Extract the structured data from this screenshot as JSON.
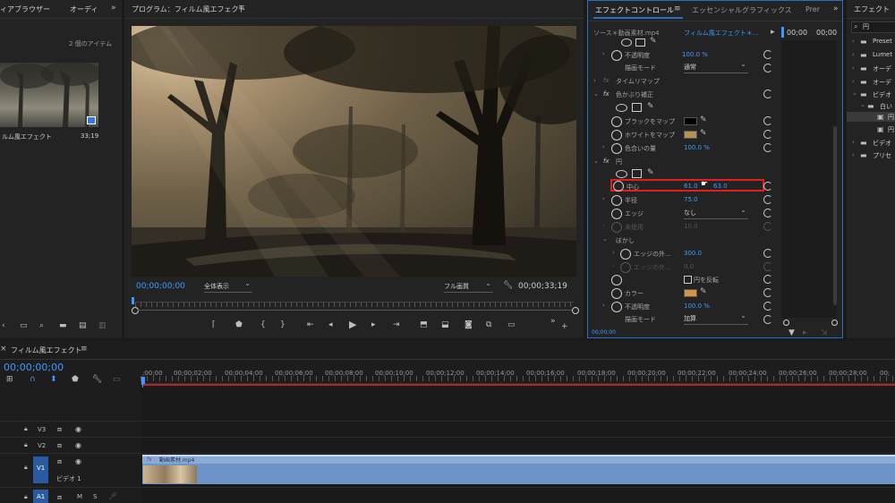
{
  "project_panel": {
    "tab_media_browser": "ィアブラウザー",
    "tab_audio": "オーディ",
    "item_count": "2 個のアイテム",
    "clip_name": "ルム風エフェクト",
    "clip_duration": "33;19"
  },
  "program_monitor": {
    "title": "プログラム：フィルム風エフェクト",
    "timecode_current": "00;00;00;00",
    "zoom_select": "全体表示",
    "quality_select": "フル画質",
    "timecode_duration": "00;00;33;19"
  },
  "effect_controls": {
    "tab_active": "エフェクトコントロール",
    "tab_essential": "エッセンシャルグラフィックス",
    "tab_more": "Prer",
    "source_label": "ソース＊動画素材.mp4",
    "sequence_label": "フィルム風エフェクト＊...",
    "mini_timecode": "00;00",
    "mini_timecode2": "00;00",
    "bottom_timecode": "00;00;00",
    "rows": [
      {
        "label": "不透明度",
        "value": "100.0 %"
      },
      {
        "label": "描画モード",
        "value": "通常"
      },
      {
        "label": "タイムリマップ",
        "value": ""
      },
      {
        "label": "色かぶり補正",
        "value": ""
      },
      {
        "label": "ブラックをマップ",
        "value": ""
      },
      {
        "label": "ホワイトをマップ",
        "value": ""
      },
      {
        "label": "色合いの量",
        "value": "100.0 %"
      },
      {
        "label": "円",
        "value": ""
      },
      {
        "label": "中心",
        "value_x": "61.0",
        "value_y": "63.0"
      },
      {
        "label": "半径",
        "value": "75.0"
      },
      {
        "label": "エッジ",
        "value": "なし"
      },
      {
        "label": "未使用",
        "value": "10.0"
      },
      {
        "label": "ぼかし",
        "value": ""
      },
      {
        "label": "エッジの外...",
        "value": "300.0"
      },
      {
        "label": "エッジの外...",
        "value": "0.0"
      },
      {
        "label": "円を反転",
        "value": ""
      },
      {
        "label": "カラー",
        "value": ""
      },
      {
        "label": "不透明度",
        "value": "100.0 %"
      },
      {
        "label": "描画モード",
        "value": "加算"
      }
    ],
    "fx_symbol": "fx",
    "swatch_black": "#000000",
    "swatch_white": "#b3925a",
    "swatch_color": "#d4954a",
    "highlight_color": "#e01f1f"
  },
  "effects_panel": {
    "tab": "エフェクト",
    "search_value": "円",
    "folders": [
      "Preset",
      "Lumet",
      "オーデ",
      "オーデ",
      "ビデオ",
      "ビデオ",
      "プリセ"
    ],
    "subitems": [
      "白い",
      "円",
      "円"
    ]
  },
  "timeline": {
    "tab": "フィルム風エフェクト",
    "timecode": "00;00;00;00",
    "ruler": [
      ";00;00",
      "00;00;02;00",
      "00;00;04;00",
      "00;00;06;00",
      "00;00;08;00",
      "00;00;10;00",
      "00;00;12;00",
      "00;00;14;00",
      "00;00;16;00",
      "00;00;18;00",
      "00;00;20;00",
      "00;00;22;00",
      "00;00;24;00",
      "00;00;26;00",
      "00;00;28;00",
      "00;"
    ],
    "tracks": {
      "v3": "V3",
      "v2": "V2",
      "v1": "V1",
      "v1_name": "ビデオ 1",
      "a1": "A1",
      "m": "M",
      "s": "S"
    },
    "clip_name": "動画素材.mp4",
    "clip_fx": "fx"
  }
}
